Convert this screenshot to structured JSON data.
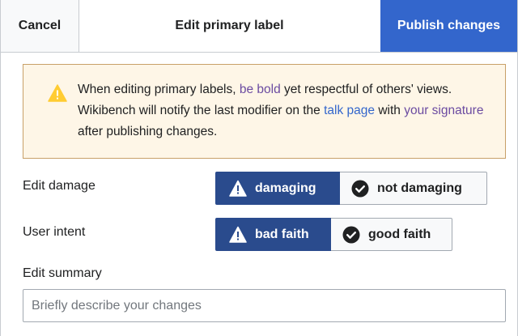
{
  "header": {
    "cancel_label": "Cancel",
    "title": "Edit primary label",
    "publish_label": "Publish changes"
  },
  "notice": {
    "text_1": "When editing primary labels, ",
    "link_be_bold": "be bold",
    "text_2": " yet respectful of others' views. Wikibench will notify the last modifier on the ",
    "link_talk_page": "talk page",
    "text_3": " with ",
    "link_signature": "your signature",
    "text_4": " after publishing changes.",
    "icon": "warning-icon"
  },
  "edit_damage": {
    "label": "Edit damage",
    "options": [
      "damaging",
      "not damaging"
    ],
    "selected": "damaging"
  },
  "user_intent": {
    "label": "User intent",
    "options": [
      "bad faith",
      "good faith"
    ],
    "selected": "bad faith"
  },
  "edit_summary": {
    "label": "Edit summary",
    "placeholder": "Briefly describe your changes",
    "value": ""
  },
  "colors": {
    "primary": "#3366cc",
    "selected": "#2a4b8d",
    "notice_bg": "#fef6e7",
    "warning": "#fc3"
  }
}
